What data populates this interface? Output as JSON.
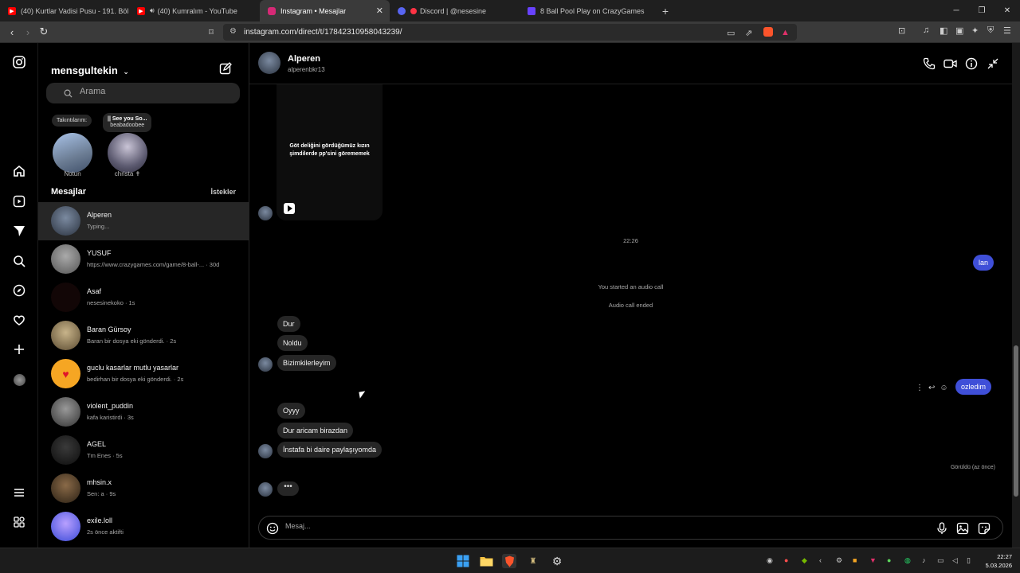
{
  "browser": {
    "tabs": [
      {
        "title": "(40) Kurtlar Vadisi Pusu - 191. Bölüm",
        "color": "#ff0000"
      },
      {
        "title": "(40) Kumralım - YouTube",
        "color": "#ff0000"
      },
      {
        "title": "Instagram • Mesajlar",
        "color": "#d62976"
      },
      {
        "title": "Discord | @nesesine",
        "color": "#5865f2"
      },
      {
        "title": "8 Ball Pool   Play on CrazyGames",
        "color": "#6842ff"
      }
    ],
    "url": "instagram.com/direct/t/17842310958043239/"
  },
  "sidebar": {
    "username": "mensgultekin",
    "search_placeholder": "Arama",
    "notes": [
      {
        "bubble": "Takıntılarım:",
        "name": "Notun"
      },
      {
        "bubble": "|| See you So...",
        "bubble2": "beabadoobee",
        "name": "christa ✝"
      }
    ],
    "section_title": "Mesajlar",
    "requests_label": "İstekler",
    "conversations": [
      {
        "name": "Alperen",
        "sub": "Typing...",
        "color": "#4a5568"
      },
      {
        "name": "YUSUF",
        "sub": "https://www.crazygames.com/game/8-ball-... · 30d",
        "color": "#666666"
      },
      {
        "name": "Asaf",
        "sub": "nesesinekoko · 1s",
        "color": "#120606"
      },
      {
        "name": "Baran Gürsoy",
        "sub": "Baran bir dosya eki gönderdi. · 2s",
        "color": "#8a7a5a"
      },
      {
        "name": "guclu kasarlar mutlu yasarlar",
        "sub": "bedirhan bir dosya eki gönderdi. · 2s",
        "color": "#f6a623"
      },
      {
        "name": "violent_puddin",
        "sub": "kafa karistirdi · 3s",
        "color": "#555555"
      },
      {
        "name": "AGEL",
        "sub": "Tm Enes · 5s",
        "color": "#1a1a1a"
      },
      {
        "name": "mhsin.x",
        "sub": "Sen: a · 9s",
        "color": "#3d3020"
      },
      {
        "name": "exile.loll",
        "sub": "2s önce aktifti",
        "color": "#3a4ad8"
      }
    ]
  },
  "chat": {
    "contact_name": "Alperen",
    "contact_handle": "alperenbkr13",
    "reel_caption": "Göt deliğini gördüğümüz kızın şimdilerde pp'sini görememek",
    "time_label": "22:26",
    "out_1": "lan",
    "sys_1": "You started an audio call",
    "sys_2": "Audio call ended",
    "in_1": "Dur",
    "in_2": "Noldu",
    "in_3": "Bizimkilerleyim",
    "out_2": "ozledim",
    "in_4": "Oyyy",
    "in_5": "Dur aricam birazdan",
    "in_6": "İnstafa bi daire paylaşıyomda",
    "seen": "Görüldü (az önce)",
    "typing": "•••",
    "composer_placeholder": "Mesaj..."
  },
  "taskbar": {
    "time": "22:27",
    "date": "5.03.2026"
  }
}
